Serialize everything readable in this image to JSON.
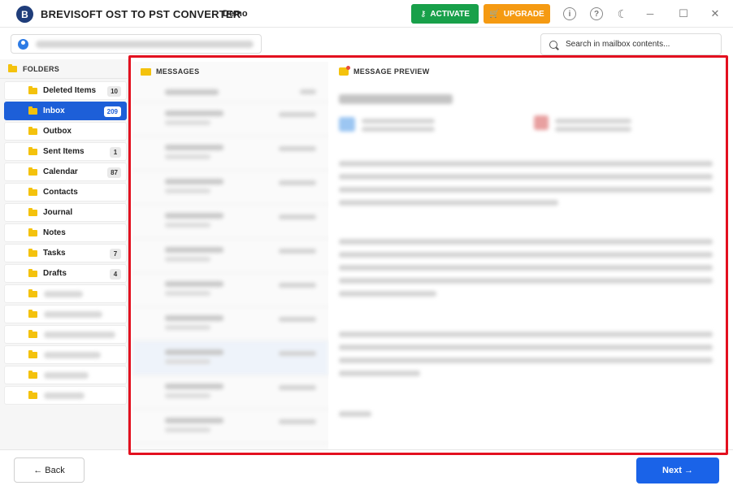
{
  "app": {
    "logo_letter": "B",
    "title": "BREVISOFT OST TO PST CONVERTER",
    "edition": "Demo"
  },
  "titlebar": {
    "activate_label": "ACTIVATE",
    "upgrade_label": "UPGRADE",
    "info_glyph": "i",
    "help_glyph": "?",
    "theme_glyph": "☾",
    "minimize_glyph": "─",
    "maximize_glyph": "☐",
    "close_glyph": "✕",
    "icons": [
      "info-icon",
      "help-icon",
      "moon-icon",
      "minimize-icon",
      "maximize-icon",
      "close-icon"
    ]
  },
  "search": {
    "placeholder": "Search in mailbox contents..."
  },
  "folders": {
    "header": "FOLDERS",
    "items": [
      {
        "name": "Deleted Items",
        "count": "10"
      },
      {
        "name": "Inbox",
        "count": "209",
        "active": true
      },
      {
        "name": "Outbox",
        "count": ""
      },
      {
        "name": "Sent Items",
        "count": "1"
      },
      {
        "name": "Calendar",
        "count": "87"
      },
      {
        "name": "Contacts",
        "count": ""
      },
      {
        "name": "Journal",
        "count": ""
      },
      {
        "name": "Notes",
        "count": ""
      },
      {
        "name": "Tasks",
        "count": "7"
      },
      {
        "name": "Drafts",
        "count": "4"
      }
    ]
  },
  "messages": {
    "header": "MESSAGES"
  },
  "preview": {
    "header": "MESSAGE PREVIEW"
  },
  "footer": {
    "back_label": "← Back",
    "next_label": "Next →"
  },
  "colors": {
    "accent": "#1d5fd8",
    "activate": "#18a04a",
    "upgrade": "#f59a12",
    "highlight": "#e3101f",
    "folder": "#f4c20d"
  }
}
